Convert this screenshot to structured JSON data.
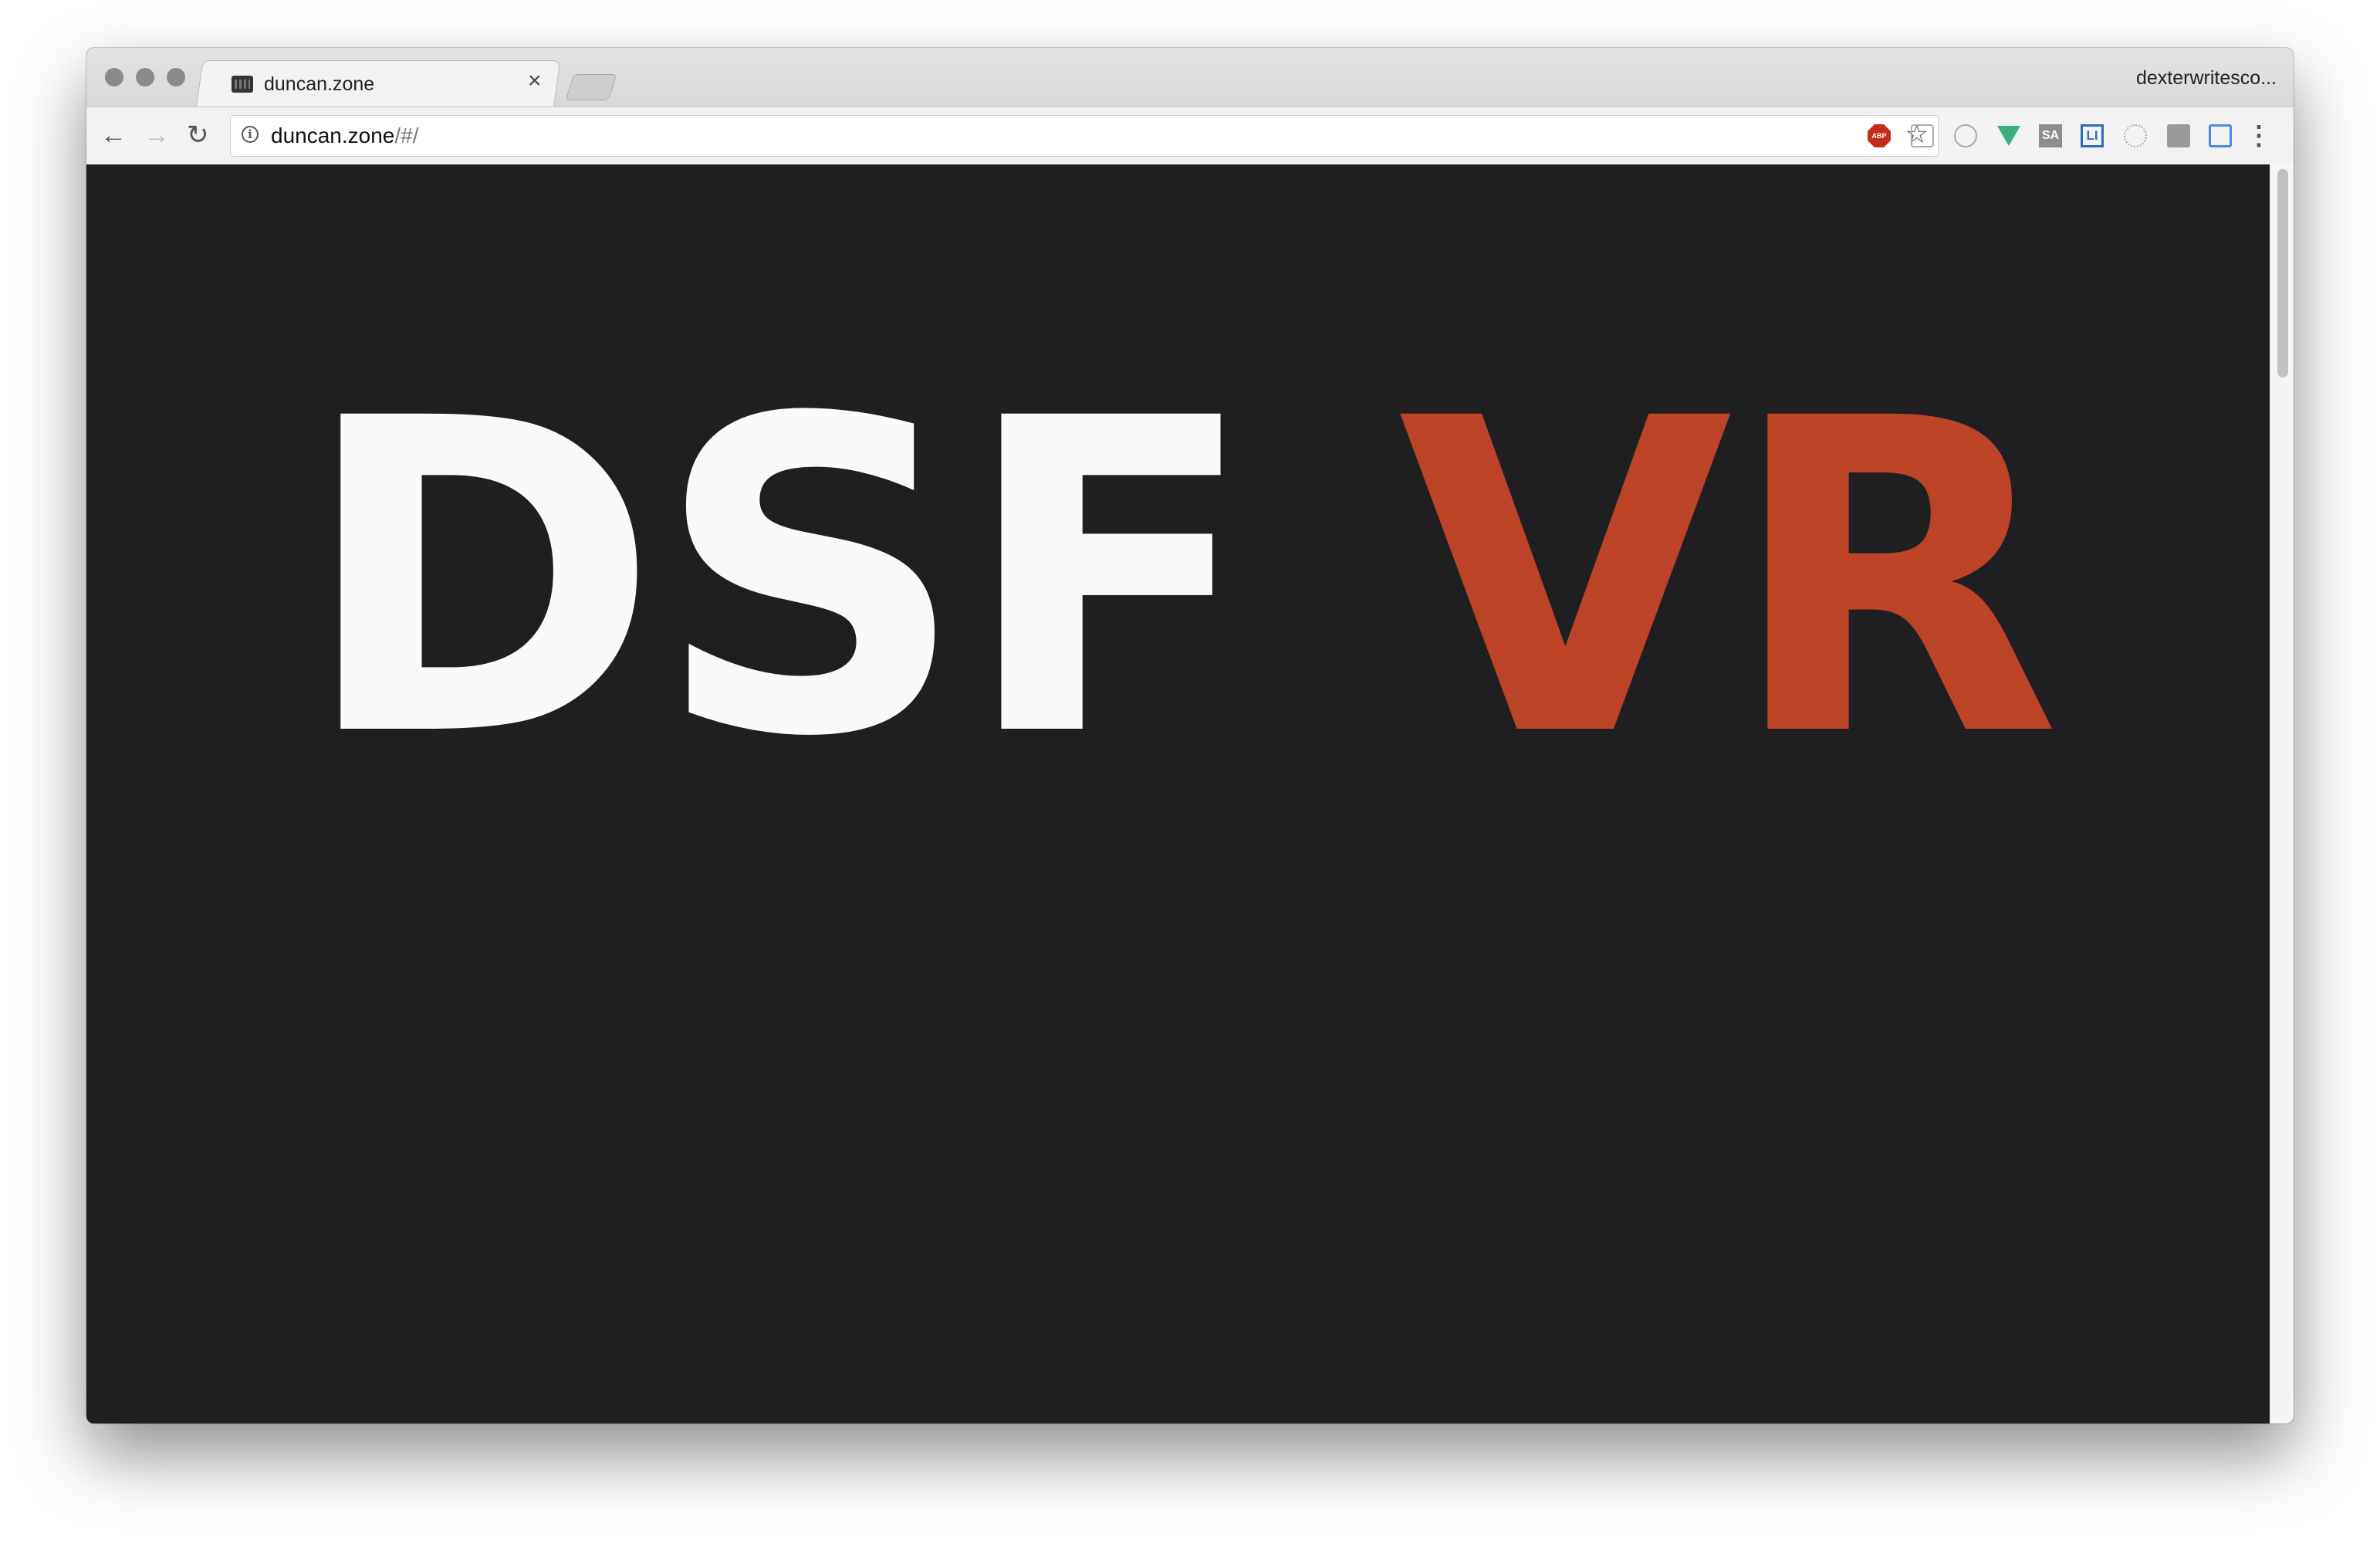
{
  "browser": {
    "tab": {
      "title": "duncan.zone",
      "close_glyph": "×",
      "icon": "film-camera-icon"
    },
    "profile_name": "dexterwritesco...",
    "nav": {
      "back_glyph": "←",
      "forward_glyph": "→",
      "reload_glyph": "↻"
    },
    "address": {
      "host": "duncan.zone",
      "path": "/#/",
      "info_glyph": "i",
      "star_glyph": "☆"
    },
    "extensions": [
      {
        "name": "adblock-plus-icon",
        "label": "ABP"
      },
      {
        "name": "chat-extension-icon",
        "label": ""
      },
      {
        "name": "circle-extension-icon",
        "label": ""
      },
      {
        "name": "vue-devtools-icon",
        "label": ""
      },
      {
        "name": "sa-extension-icon",
        "label": "SA"
      },
      {
        "name": "li-extension-icon",
        "label": "LI"
      },
      {
        "name": "react-devtools-icon",
        "label": ""
      },
      {
        "name": "reader-extension-icon",
        "label": ""
      },
      {
        "name": "cast-icon",
        "label": ""
      }
    ],
    "menu_glyph": "⋮"
  },
  "page": {
    "hero_white": "DSF",
    "hero_red": "VR",
    "colors": {
      "background": "#1f1f21",
      "white": "#fafafa",
      "red": "#bd4326"
    }
  }
}
